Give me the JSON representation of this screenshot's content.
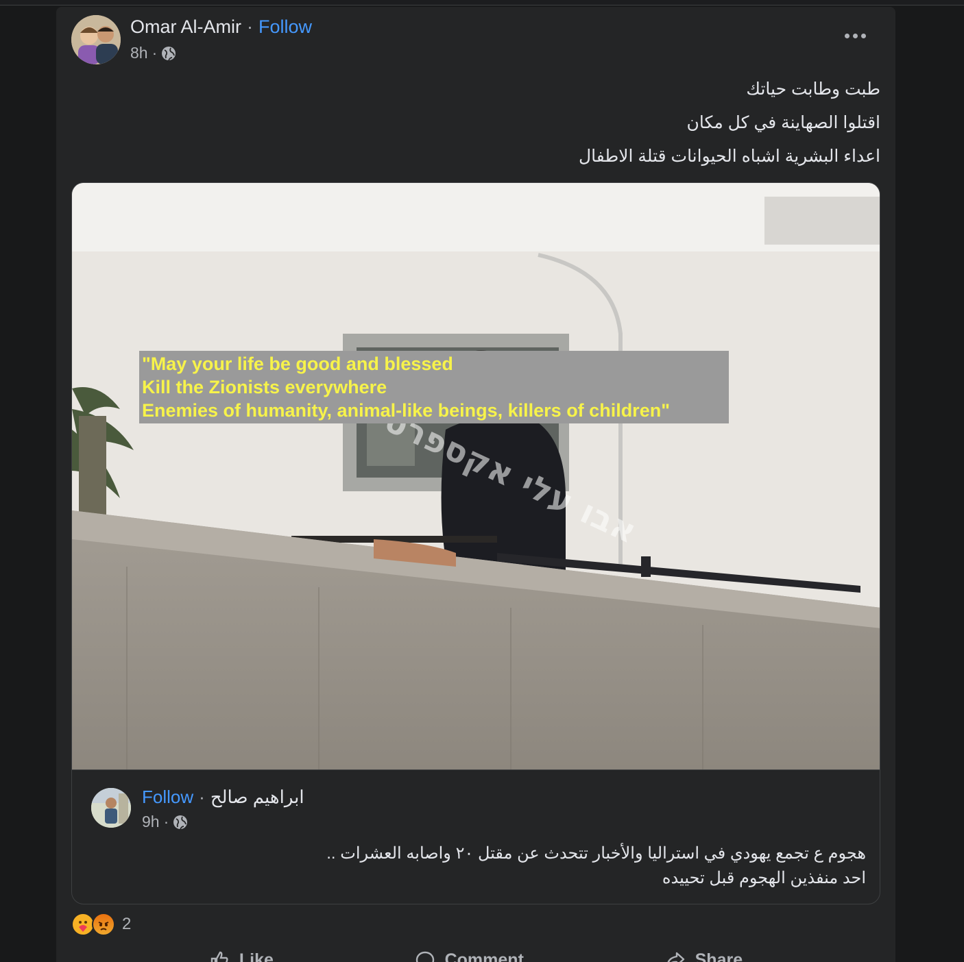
{
  "post": {
    "author": "Omar Al-Amir",
    "separator": "·",
    "follow_label": "Follow",
    "time": "8h",
    "meta_separator": "·",
    "privacy_icon": "globe-icon",
    "more_icon": "more-options-icon",
    "text_lines": [
      "طبت وطابت حياتك",
      "اقتلوا الصهاينة في كل مكان",
      "اعداء البشرية اشباه الحيوانات قتلة الاطفال"
    ]
  },
  "translation_overlay": {
    "lines": [
      "\"May your life be good and blessed",
      "Kill the Zionists everywhere",
      "Enemies of humanity, animal-like beings, killers of children\""
    ]
  },
  "photo": {
    "watermark": "אבו עלי אקספרס"
  },
  "shared_post": {
    "author": "ابراهيم صالح",
    "separator": "·",
    "follow_label": "Follow",
    "time": "9h",
    "meta_separator": "·",
    "text_lines": [
      "هجوم ع تجمع يهودي في استراليا والأخبار تتحدث عن مقتل ٢٠ واصابه العشرات ..",
      "احد منفذين الهجوم قبل تحييده"
    ]
  },
  "reactions": {
    "types": [
      "care",
      "angry"
    ],
    "count": "2"
  },
  "actions": {
    "like": "Like",
    "comment": "Comment",
    "share": "Share"
  },
  "colors": {
    "background": "#18191a",
    "card": "#242526",
    "link": "#4599ff",
    "overlay_text": "#f7f34a",
    "overlay_bg": "#9a9a9a"
  }
}
